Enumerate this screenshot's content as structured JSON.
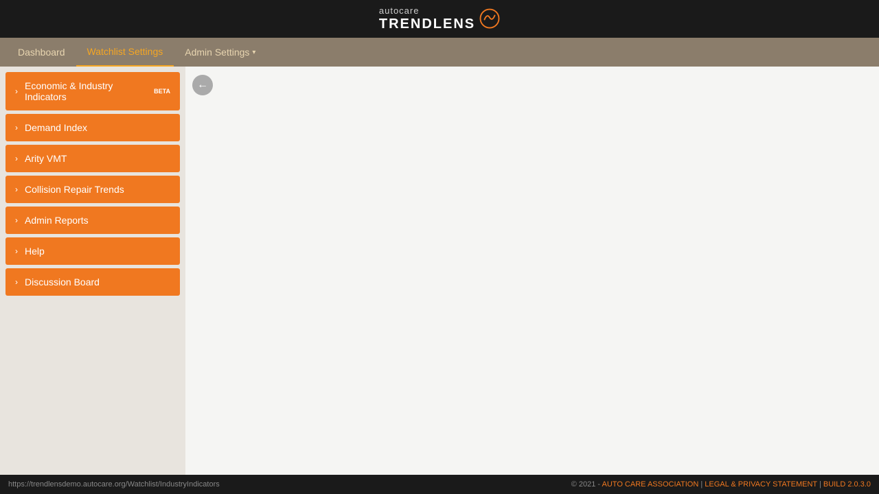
{
  "header": {
    "logo_autocare": "autocare",
    "logo_trendlens": "TRENDLENS"
  },
  "nav": {
    "items": [
      {
        "label": "Dashboard",
        "active": false
      },
      {
        "label": "Watchlist Settings",
        "active": true
      },
      {
        "label": "Admin Settings",
        "active": false,
        "has_dropdown": true
      }
    ]
  },
  "sidebar": {
    "items": [
      {
        "label": "Economic & Industry Indicators",
        "badge": "BETA"
      },
      {
        "label": "Demand Index",
        "badge": null
      },
      {
        "label": "Arity VMT",
        "badge": null
      },
      {
        "label": "Collision Repair Trends",
        "badge": null
      },
      {
        "label": "Admin Reports",
        "badge": null
      },
      {
        "label": "Help",
        "badge": null
      },
      {
        "label": "Discussion Board",
        "badge": null
      }
    ]
  },
  "footer": {
    "url": "https://trendlensdemo.autocare.org/Watchlist/IndustryIndicators",
    "copyright": "© 2021 -",
    "links": {
      "association": "AUTO CARE ASSOCIATION",
      "legal": "LEGAL & PRIVACY STATEMENT",
      "build": "BUILD 2.0.3.0"
    },
    "separator": "|"
  },
  "icons": {
    "chevron_right": "›",
    "back_arrow": "←",
    "dropdown_arrow": "▾"
  }
}
